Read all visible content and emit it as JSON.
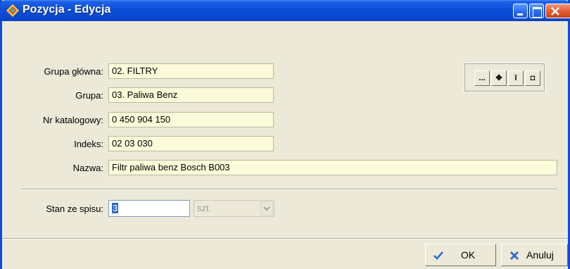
{
  "window": {
    "title": "Pozycja - Edycja"
  },
  "form": {
    "fields": [
      {
        "label": "Grupa główna:",
        "value": "02. FILTRY"
      },
      {
        "label": "Grupa:",
        "value": "03. Paliwa Benz"
      },
      {
        "label": "Nr katalogowy:",
        "value": "0 450 904 150"
      },
      {
        "label": "Indeks:",
        "value": "02 03 030"
      },
      {
        "label": "Nazwa:",
        "value": "Filtr paliwa benz Bosch B003"
      }
    ],
    "stock_label": "Stan ze spisu:",
    "stock_value": "3",
    "unit_value": "szt."
  },
  "toolbox": {
    "buttons": [
      {
        "glyph": "...",
        "icon": "ellipsis-icon"
      },
      {
        "glyph": "✥",
        "icon": "move-icon"
      },
      {
        "glyph": "ĭ",
        "icon": "info-icon"
      },
      {
        "glyph": "◘",
        "icon": "record-icon"
      }
    ]
  },
  "actions": {
    "ok_label": "OK",
    "cancel_label": "Anuluj"
  },
  "colors": {
    "titlebar": "#0a4fd8",
    "field_bg": "#fbfad9",
    "window_bg": "#ece9d8"
  }
}
